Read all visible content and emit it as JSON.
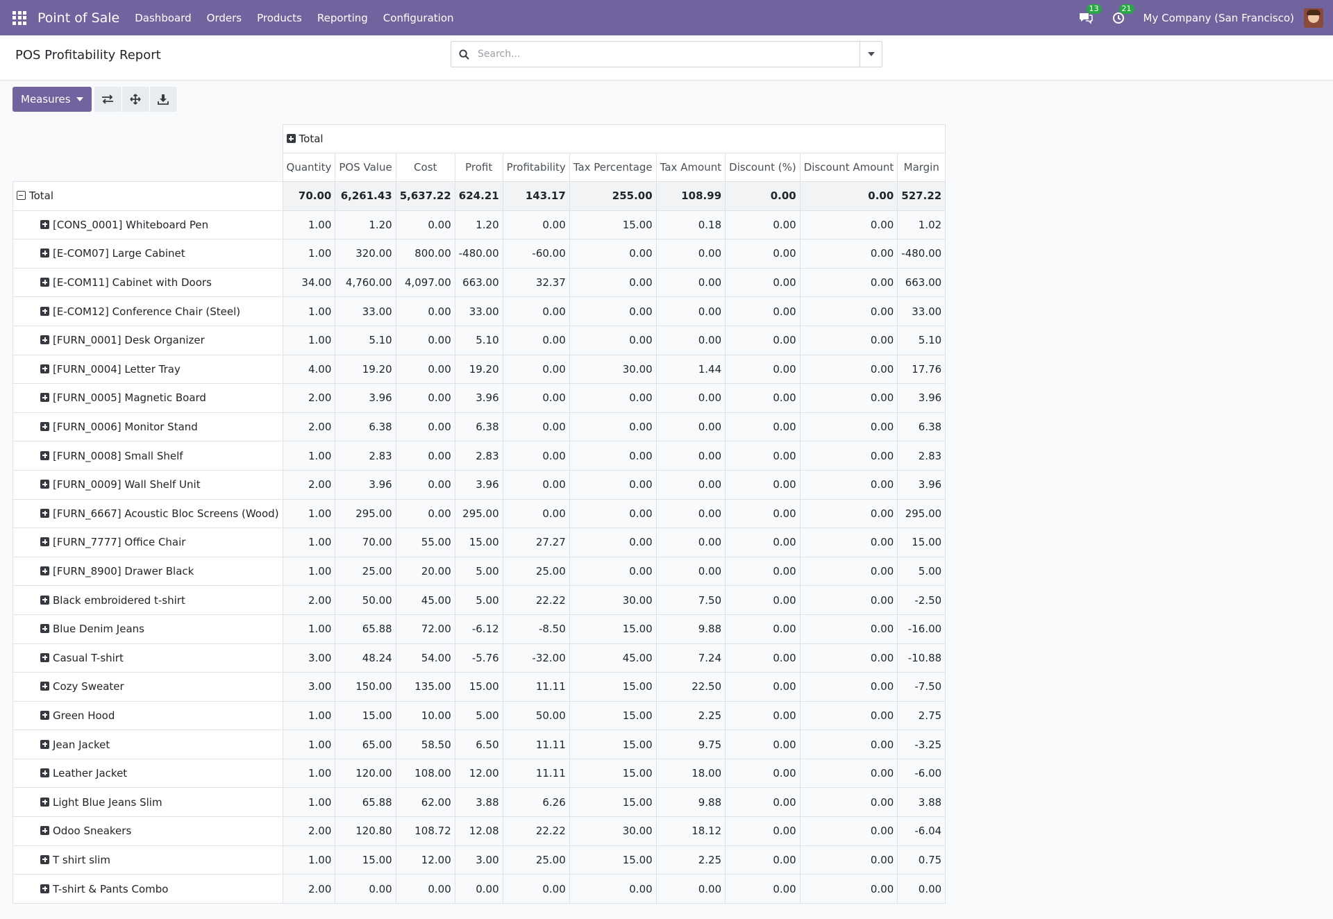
{
  "navbar": {
    "app_name": "Point of Sale",
    "menu": [
      "Dashboard",
      "Orders",
      "Products",
      "Reporting",
      "Configuration"
    ],
    "messages_count": "13",
    "activities_count": "21",
    "company": "My Company (San Francisco)"
  },
  "control_panel": {
    "title": "POS Profitability Report",
    "search_placeholder": "Search..."
  },
  "toolbar": {
    "measures_label": "Measures",
    "icons": [
      "flip-axis-icon",
      "expand-all-icon",
      "download-icon"
    ]
  },
  "pivot": {
    "column_group": "Total",
    "measures": [
      "Quantity",
      "POS Value",
      "Cost",
      "Profit",
      "Profitability",
      "Tax Percentage",
      "Tax Amount",
      "Discount (%)",
      "Discount Amount",
      "Margin"
    ],
    "total_row": {
      "label": "Total",
      "values": [
        "70.00",
        "6,261.43",
        "5,637.22",
        "624.21",
        "143.17",
        "255.00",
        "108.99",
        "0.00",
        "0.00",
        "527.22"
      ]
    },
    "rows": [
      {
        "label": "[CONS_0001] Whiteboard Pen",
        "values": [
          "1.00",
          "1.20",
          "0.00",
          "1.20",
          "0.00",
          "15.00",
          "0.18",
          "0.00",
          "0.00",
          "1.02"
        ]
      },
      {
        "label": "[E-COM07] Large Cabinet",
        "values": [
          "1.00",
          "320.00",
          "800.00",
          "-480.00",
          "-60.00",
          "0.00",
          "0.00",
          "0.00",
          "0.00",
          "-480.00"
        ]
      },
      {
        "label": "[E-COM11] Cabinet with Doors",
        "values": [
          "34.00",
          "4,760.00",
          "4,097.00",
          "663.00",
          "32.37",
          "0.00",
          "0.00",
          "0.00",
          "0.00",
          "663.00"
        ]
      },
      {
        "label": "[E-COM12] Conference Chair (Steel)",
        "values": [
          "1.00",
          "33.00",
          "0.00",
          "33.00",
          "0.00",
          "0.00",
          "0.00",
          "0.00",
          "0.00",
          "33.00"
        ]
      },
      {
        "label": "[FURN_0001] Desk Organizer",
        "values": [
          "1.00",
          "5.10",
          "0.00",
          "5.10",
          "0.00",
          "0.00",
          "0.00",
          "0.00",
          "0.00",
          "5.10"
        ]
      },
      {
        "label": "[FURN_0004] Letter Tray",
        "values": [
          "4.00",
          "19.20",
          "0.00",
          "19.20",
          "0.00",
          "30.00",
          "1.44",
          "0.00",
          "0.00",
          "17.76"
        ]
      },
      {
        "label": "[FURN_0005] Magnetic Board",
        "values": [
          "2.00",
          "3.96",
          "0.00",
          "3.96",
          "0.00",
          "0.00",
          "0.00",
          "0.00",
          "0.00",
          "3.96"
        ]
      },
      {
        "label": "[FURN_0006] Monitor Stand",
        "values": [
          "2.00",
          "6.38",
          "0.00",
          "6.38",
          "0.00",
          "0.00",
          "0.00",
          "0.00",
          "0.00",
          "6.38"
        ]
      },
      {
        "label": "[FURN_0008] Small Shelf",
        "values": [
          "1.00",
          "2.83",
          "0.00",
          "2.83",
          "0.00",
          "0.00",
          "0.00",
          "0.00",
          "0.00",
          "2.83"
        ]
      },
      {
        "label": "[FURN_0009] Wall Shelf Unit",
        "values": [
          "2.00",
          "3.96",
          "0.00",
          "3.96",
          "0.00",
          "0.00",
          "0.00",
          "0.00",
          "0.00",
          "3.96"
        ]
      },
      {
        "label": "[FURN_6667] Acoustic Bloc Screens (Wood)",
        "values": [
          "1.00",
          "295.00",
          "0.00",
          "295.00",
          "0.00",
          "0.00",
          "0.00",
          "0.00",
          "0.00",
          "295.00"
        ]
      },
      {
        "label": "[FURN_7777] Office Chair",
        "values": [
          "1.00",
          "70.00",
          "55.00",
          "15.00",
          "27.27",
          "0.00",
          "0.00",
          "0.00",
          "0.00",
          "15.00"
        ]
      },
      {
        "label": "[FURN_8900] Drawer Black",
        "values": [
          "1.00",
          "25.00",
          "20.00",
          "5.00",
          "25.00",
          "0.00",
          "0.00",
          "0.00",
          "0.00",
          "5.00"
        ]
      },
      {
        "label": "Black embroidered t-shirt",
        "values": [
          "2.00",
          "50.00",
          "45.00",
          "5.00",
          "22.22",
          "30.00",
          "7.50",
          "0.00",
          "0.00",
          "-2.50"
        ]
      },
      {
        "label": "Blue Denim Jeans",
        "values": [
          "1.00",
          "65.88",
          "72.00",
          "-6.12",
          "-8.50",
          "15.00",
          "9.88",
          "0.00",
          "0.00",
          "-16.00"
        ]
      },
      {
        "label": "Casual T-shirt",
        "values": [
          "3.00",
          "48.24",
          "54.00",
          "-5.76",
          "-32.00",
          "45.00",
          "7.24",
          "0.00",
          "0.00",
          "-10.88"
        ]
      },
      {
        "label": "Cozy Sweater",
        "values": [
          "3.00",
          "150.00",
          "135.00",
          "15.00",
          "11.11",
          "15.00",
          "22.50",
          "0.00",
          "0.00",
          "-7.50"
        ]
      },
      {
        "label": "Green Hood",
        "values": [
          "1.00",
          "15.00",
          "10.00",
          "5.00",
          "50.00",
          "15.00",
          "2.25",
          "0.00",
          "0.00",
          "2.75"
        ]
      },
      {
        "label": "Jean Jacket",
        "values": [
          "1.00",
          "65.00",
          "58.50",
          "6.50",
          "11.11",
          "15.00",
          "9.75",
          "0.00",
          "0.00",
          "-3.25"
        ]
      },
      {
        "label": "Leather Jacket",
        "values": [
          "1.00",
          "120.00",
          "108.00",
          "12.00",
          "11.11",
          "15.00",
          "18.00",
          "0.00",
          "0.00",
          "-6.00"
        ]
      },
      {
        "label": "Light Blue Jeans Slim",
        "values": [
          "1.00",
          "65.88",
          "62.00",
          "3.88",
          "6.26",
          "15.00",
          "9.88",
          "0.00",
          "0.00",
          "3.88"
        ]
      },
      {
        "label": "Odoo Sneakers",
        "values": [
          "2.00",
          "120.80",
          "108.72",
          "12.08",
          "22.22",
          "30.00",
          "18.12",
          "0.00",
          "0.00",
          "-6.04"
        ]
      },
      {
        "label": "T shirt slim",
        "values": [
          "1.00",
          "15.00",
          "12.00",
          "3.00",
          "25.00",
          "15.00",
          "2.25",
          "0.00",
          "0.00",
          "0.75"
        ]
      },
      {
        "label": "T-shirt & Pants Combo",
        "values": [
          "2.00",
          "0.00",
          "0.00",
          "0.00",
          "0.00",
          "0.00",
          "0.00",
          "0.00",
          "0.00",
          "0.00"
        ]
      }
    ]
  }
}
